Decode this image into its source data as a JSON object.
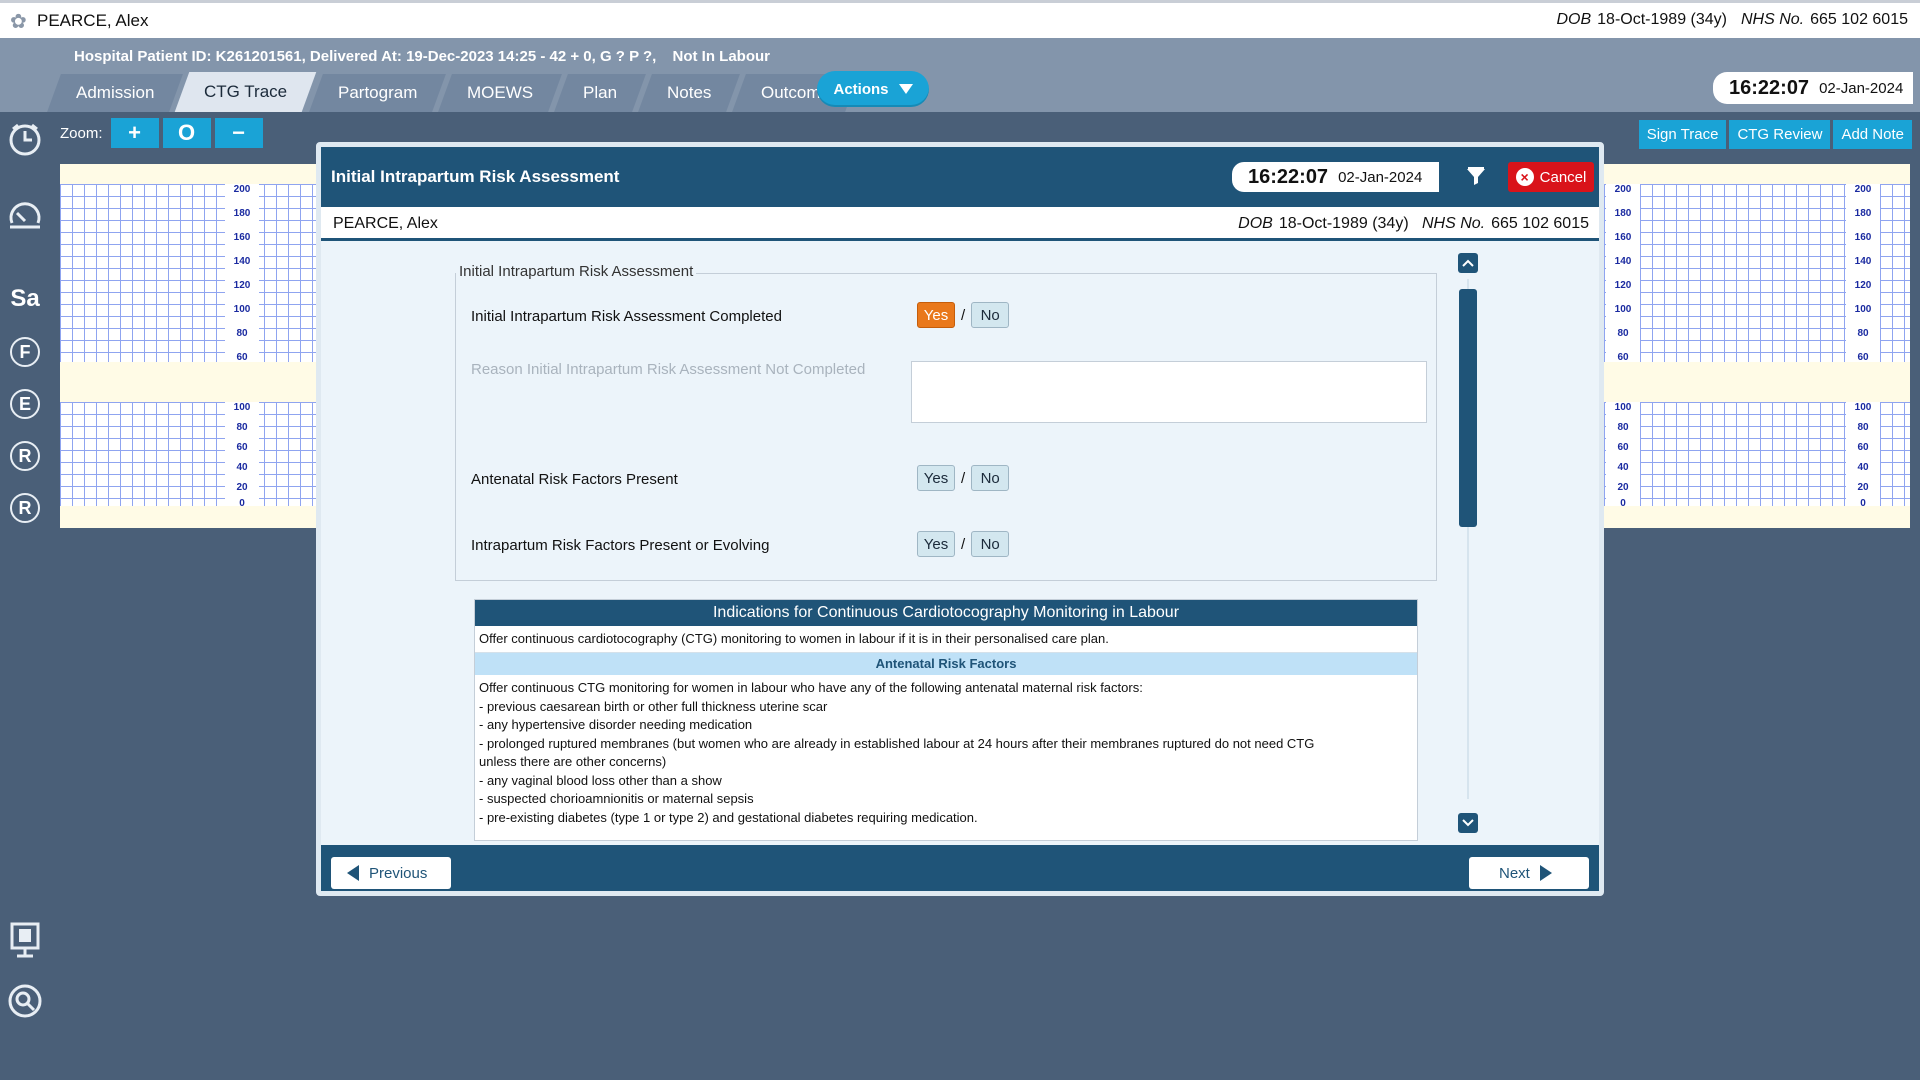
{
  "patient": {
    "name": "PEARCE, Alex",
    "dob_label": "DOB",
    "dob": "18-Oct-1989 (34y)",
    "nhs_label": "NHS No.",
    "nhs": "665 102 6015"
  },
  "header": {
    "hospital_info": "Hospital Patient ID: K261201561, Delivered At: 19-Dec-2023 14:25 - 42 + 0, G ? P ?,",
    "labour_status": "Not In Labour",
    "tabs": [
      {
        "label": "Admission"
      },
      {
        "label": "CTG Trace"
      },
      {
        "label": "Partogram"
      },
      {
        "label": "MOEWS"
      },
      {
        "label": "Plan"
      },
      {
        "label": "Notes"
      },
      {
        "label": "Outcome"
      }
    ],
    "active_tab": "CTG Trace",
    "actions_label": "Actions",
    "time": "16:22:07",
    "date": "02-Jan-2024"
  },
  "sidebar": {
    "letters": [
      "Sa",
      "F",
      "E",
      "R",
      "R"
    ]
  },
  "toolbar": {
    "zoom_label": "Zoom:",
    "zoom_in": "+",
    "zoom_reset": "O",
    "zoom_out": "−",
    "sign_trace": "Sign Trace",
    "ctg_review": "CTG Review",
    "add_note": "Add Note"
  },
  "ctg": {
    "fhr_ticks": [
      "200",
      "180",
      "160",
      "140",
      "120",
      "100",
      "80",
      "60"
    ],
    "toco_ticks": [
      "100",
      "80",
      "60",
      "40",
      "20",
      "0"
    ]
  },
  "modal": {
    "title": "Initial Intrapartum Risk Assessment",
    "time": "16:22:07",
    "date": "02-Jan-2024",
    "cancel_label": "Cancel",
    "fieldset_legend": "Initial Intrapartum Risk Assessment",
    "q1_label": "Initial Intrapartum Risk Assessment Completed",
    "q1_value": "Yes",
    "reason_label": "Reason Initial Intrapartum Risk Assessment Not Completed",
    "q2_label": "Antenatal Risk Factors Present",
    "q3_label": "Intrapartum Risk Factors Present or Evolving",
    "yes": "Yes",
    "no": "No",
    "slash": "/",
    "info_title": "Indications for Continuous Cardiotocography Monitoring in Labour",
    "info_intro": "Offer continuous cardiotocography (CTG) monitoring to women in labour if it is in their personalised care plan.",
    "info_subheading": "Antenatal Risk Factors",
    "info_lines": [
      "Offer continuous CTG monitoring for women in labour who have any of the following antenatal maternal risk factors:",
      "- previous caesarean birth or other full thickness uterine scar",
      "- any hypertensive disorder needing medication",
      "- prolonged ruptured membranes (but women who are already in established labour at 24 hours after their membranes ruptured do not need CTG",
      "unless there are other concerns)",
      "- any vaginal blood loss other than a show",
      "- suspected chorioamnionitis or maternal sepsis",
      "- pre-existing diabetes (type 1 or type 2) and gestational diabetes requiring medication."
    ],
    "previous_label": "Previous",
    "next_label": "Next"
  }
}
